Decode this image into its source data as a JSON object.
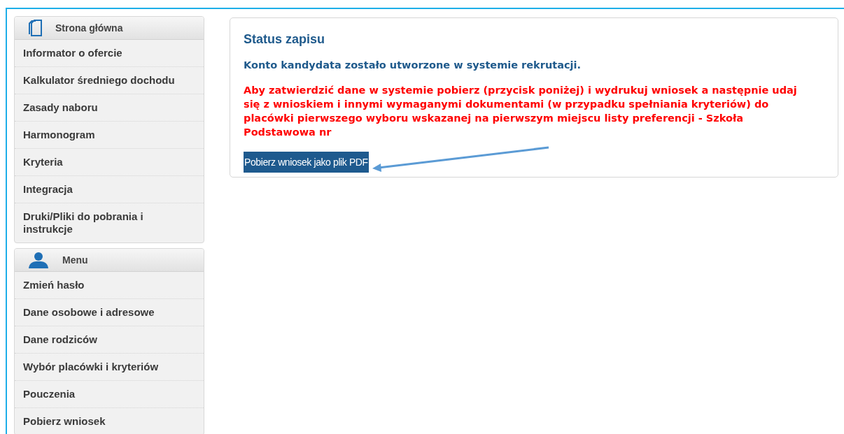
{
  "sidebar": [
    {
      "kind": "pages",
      "title": "Strona główna",
      "items": [
        "Informator o ofercie",
        "Kalkulator średniego dochodu",
        "Zasady naboru",
        "Harmonogram",
        "Kryteria",
        "Integracja",
        "Druki/Pliki do pobrania i instrukcje"
      ]
    },
    {
      "kind": "user",
      "title": "Menu",
      "items": [
        "Zmień hasło",
        "Dane osobowe i adresowe",
        "Dane rodziców",
        "Wybór placówki i kryteriów",
        "Pouczenia",
        "Pobierz wniosek"
      ]
    }
  ],
  "status": {
    "title": "Status zapisu",
    "message": "Konto kandydata zostało utworzone w systemie rekrutacji.",
    "warning": "Aby zatwierdzić dane w systemie pobierz (przycisk poniżej) i wydrukuj wniosek a następnie udaj się z wnioskiem i innymi wymaganymi dokumentami (w przypadku spełniania kryteriów) do placówki pierwszego wyboru wskazanej na pierwszym miejscu listy preferencji - Szkoła Podstawowa nr",
    "button": "Pobierz wniosek jako plik PDF"
  }
}
